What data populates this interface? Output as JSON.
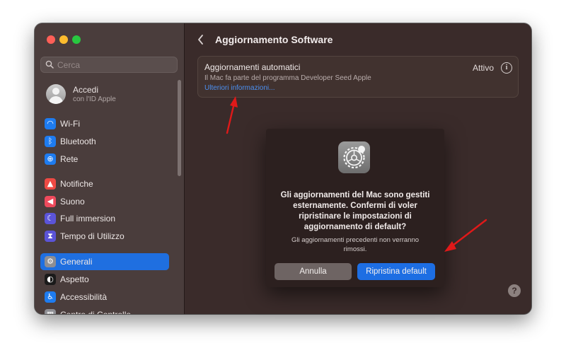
{
  "sidebar": {
    "search_placeholder": "Cerca",
    "account": {
      "name": "Accedi",
      "subtitle": "con l'ID Apple"
    },
    "items": [
      {
        "label": "Wi-Fi",
        "icon": "wifi-icon",
        "color": "#1e7cf0",
        "glyph": "◠"
      },
      {
        "label": "Bluetooth",
        "icon": "bluetooth-icon",
        "color": "#1e7cf0",
        "glyph": "ᛒ"
      },
      {
        "label": "Rete",
        "icon": "globe-icon",
        "color": "#1e7cf0",
        "glyph": "⊕"
      },
      {
        "label": "Notifiche",
        "icon": "bell-icon",
        "color": "#ee4a44",
        "glyph": "▲"
      },
      {
        "label": "Suono",
        "icon": "speaker-icon",
        "color": "#ee4a5c",
        "glyph": "◀"
      },
      {
        "label": "Full immersion",
        "icon": "moon-icon",
        "color": "#5b54d8",
        "glyph": "☾"
      },
      {
        "label": "Tempo di Utilizzo",
        "icon": "hourglass-icon",
        "color": "#5b54d8",
        "glyph": "⧗"
      },
      {
        "label": "Generali",
        "icon": "gear-icon",
        "color": "#8e8e93",
        "glyph": "⚙",
        "selected": true
      },
      {
        "label": "Aspetto",
        "icon": "appearance-icon",
        "color": "#1a1a1a",
        "glyph": "◐"
      },
      {
        "label": "Accessibilità",
        "icon": "accessibility-icon",
        "color": "#1e7cf0",
        "glyph": "♿"
      },
      {
        "label": "Centro di Controllo",
        "icon": "control-center-icon",
        "color": "#8e8e93",
        "glyph": "▦"
      }
    ]
  },
  "main": {
    "title": "Aggiornamento Software",
    "card": {
      "title": "Aggiornamenti automatici",
      "subtitle": "Il Mac fa parte del programma Developer Seed Apple",
      "link": "Ulteriori informazioni...",
      "status": "Attivo"
    },
    "help": "?"
  },
  "dialog": {
    "title": "Gli aggiornamenti del Mac sono gestiti esternamente. Confermi di voler ripristinare le impostazioni di aggiornamento di default?",
    "message": "Gli aggiornamenti precedenti non verranno rimossi.",
    "cancel_label": "Annulla",
    "confirm_label": "Ripristina default"
  },
  "colors": {
    "accent": "#1d6ee3",
    "annotation_arrow": "#e01919"
  }
}
